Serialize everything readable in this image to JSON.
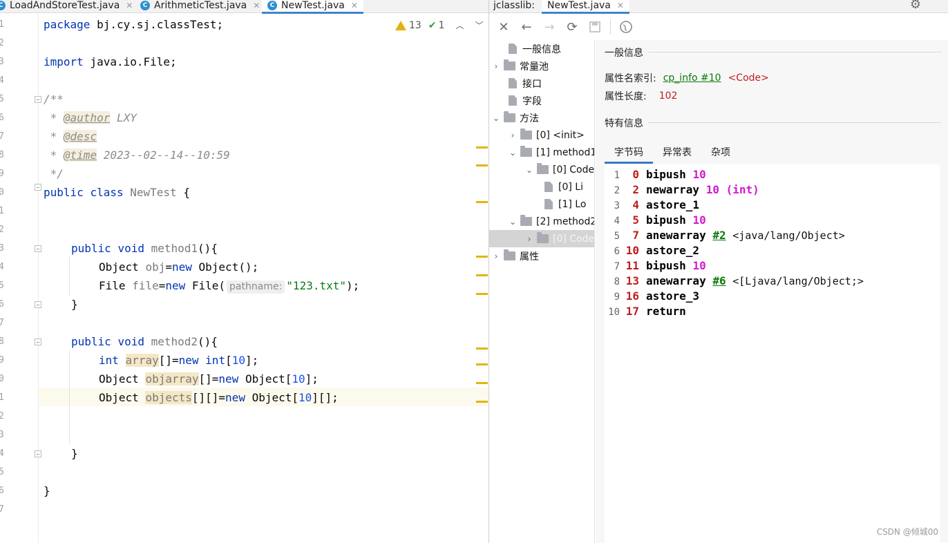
{
  "editor": {
    "tabs": [
      {
        "label": "LoadAndStoreTest.java",
        "active": false
      },
      {
        "label": "ArithmeticTest.java",
        "active": false
      },
      {
        "label": "NewTest.java",
        "active": true
      }
    ],
    "inspection": {
      "warnings": "13",
      "checks": "1"
    },
    "line_numbers": [
      "1",
      "2",
      "3",
      "4",
      "5",
      "6",
      "7",
      "8",
      "9",
      "0",
      "1",
      "2",
      "3",
      "4",
      "5",
      "6",
      "7",
      "8",
      "9",
      "0",
      "1",
      "2",
      "3",
      "4",
      "5",
      "6",
      "7"
    ],
    "code": {
      "l1_kw": "package",
      "l1_rest": " bj.cy.sj.classTest;",
      "l3_kw": "import",
      "l3_rest": " java.io.File;",
      "l5": "/**",
      "l6_pre": " * ",
      "l6_tag": "@author",
      "l6_rest": " LXY",
      "l7_pre": " * ",
      "l7_tag": "@desc",
      "l8_pre": " * ",
      "l8_tag": "@time",
      "l8_rest": " 2023--02--14--10:59",
      "l9": " */",
      "l10_kw1": "public",
      "l10_kw2": "class",
      "l10_name": "NewTest",
      "l10_rest": " {",
      "l13_kw1": "public",
      "l13_kw2": "void",
      "l13_name": "method1",
      "l13_rest": "(){",
      "l14_type": "Object ",
      "l14_var": "obj",
      "l14_eq": "=",
      "l14_kw": "new",
      "l14_rest": " Object();",
      "l15_type": "File ",
      "l15_var": "file",
      "l15_eq": "=",
      "l15_kw": "new",
      "l15_call": " File(",
      "l15_hint": "pathname:",
      "l15_str": "\"123.txt\"",
      "l15_end": ");",
      "l16": "}",
      "l18_kw1": "public",
      "l18_kw2": "void",
      "l18_name": "method2",
      "l18_rest": "(){",
      "l19_kw": "int",
      "l19_var": "array",
      "l19_mid": "[]=",
      "l19_new": "new",
      "l19_int": "int",
      "l19_b1": "[",
      "l19_num": "10",
      "l19_end": "];",
      "l20_type": "Object ",
      "l20_var": "objarray",
      "l20_mid": "[]=",
      "l20_new": "new",
      "l20_call": " Object[",
      "l20_num": "10",
      "l20_end": "];",
      "l21_type": "Object ",
      "l21_var": "objects",
      "l21_mid": "[][]=",
      "l21_new": "new",
      "l21_call": " Object[",
      "l21_num": "10",
      "l21_end": "][];",
      "l24": "}",
      "l26": "}"
    }
  },
  "jclasslib": {
    "tabs": [
      {
        "label": "jclasslib:",
        "active": false
      },
      {
        "label": "NewTest.java",
        "active": true
      }
    ],
    "toolbar": [
      "close-icon",
      "back-icon",
      "forward-icon",
      "refresh-icon",
      "save-icon",
      "browser-icon"
    ],
    "tree": [
      {
        "label": "一般信息"
      },
      {
        "label": "常量池"
      },
      {
        "label": "接口"
      },
      {
        "label": "字段"
      },
      {
        "label": "方法"
      },
      {
        "label": "[0] <init>"
      },
      {
        "label": "[1] method1"
      },
      {
        "label": "[0] Code"
      },
      {
        "label": "[0] Li"
      },
      {
        "label": "[1] Lo"
      },
      {
        "label": "[2] method2"
      },
      {
        "label": "[0] Code"
      },
      {
        "label": "属性"
      }
    ],
    "detail": {
      "general_title": "一般信息",
      "attr_name_label": "属性名索引:",
      "attr_name_link": "cp_info #10",
      "attr_name_value": "<Code>",
      "attr_len_label": "属性长度:",
      "attr_len_value": "102",
      "specific_title": "特有信息",
      "tabs": [
        {
          "label": "字节码",
          "active": true
        },
        {
          "label": "异常表",
          "active": false
        },
        {
          "label": "杂项",
          "active": false
        }
      ],
      "bytecode": [
        {
          "line": "1",
          "offset": "0",
          "op": "bipush",
          "arg": "10"
        },
        {
          "line": "2",
          "offset": "2",
          "op": "newarray",
          "arg": "10 (int)"
        },
        {
          "line": "3",
          "offset": "4",
          "op": "astore_1"
        },
        {
          "line": "4",
          "offset": "5",
          "op": "bipush",
          "arg": "10"
        },
        {
          "line": "5",
          "offset": "7",
          "op": "anewarray",
          "link": "#2",
          "comment": "<java/lang/Object>"
        },
        {
          "line": "6",
          "offset": "10",
          "op": "astore_2"
        },
        {
          "line": "7",
          "offset": "11",
          "op": "bipush",
          "arg": "10"
        },
        {
          "line": "8",
          "offset": "13",
          "op": "anewarray",
          "link": "#6",
          "comment": "<[Ljava/lang/Object;>"
        },
        {
          "line": "9",
          "offset": "16",
          "op": "astore_3"
        },
        {
          "line": "10",
          "offset": "17",
          "op": "return"
        }
      ]
    }
  },
  "watermark": "CSDN @倾城00",
  "colors": {
    "accent": "#4083c9",
    "keyword": "#0033b3",
    "offset_red": "#c01c1c",
    "arg_magenta": "#d01bd0",
    "link_green": "#0a7a0a",
    "marker_yellow": "#e2b507"
  }
}
